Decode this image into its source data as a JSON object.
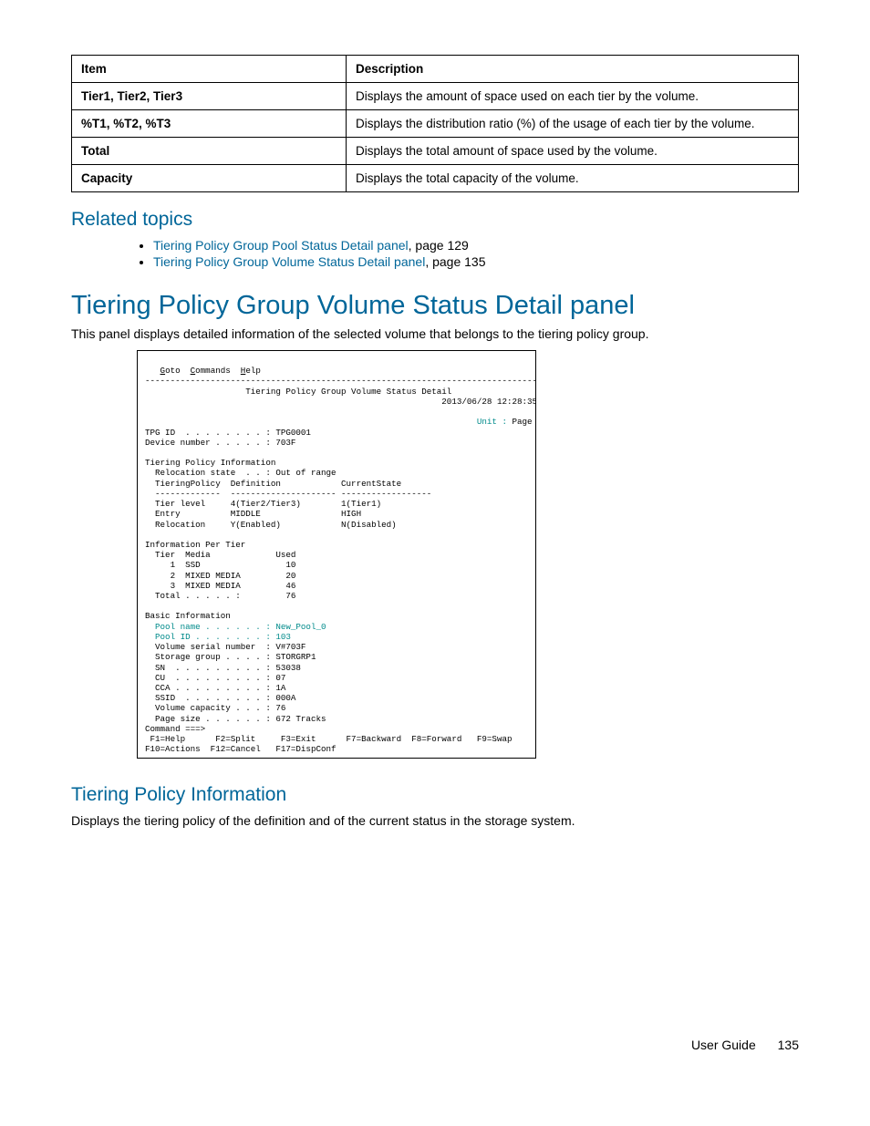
{
  "table": {
    "headers": [
      "Item",
      "Description"
    ],
    "rows": [
      {
        "item": "Tier1, Tier2, Tier3",
        "desc": "Displays the amount of space used on each tier by the volume."
      },
      {
        "item": "%T1, %T2, %T3",
        "desc": "Displays the distribution ratio (%) of the usage of each tier by the volume."
      },
      {
        "item": "Total",
        "desc": "Displays the total amount of space used by the volume."
      },
      {
        "item": "Capacity",
        "desc": "Displays the total capacity of the volume."
      }
    ]
  },
  "related": {
    "heading": "Related topics",
    "items": [
      {
        "link": "Tiering Policy Group Pool Status Detail panel",
        "suffix": ", page 129"
      },
      {
        "link": "Tiering Policy Group Volume Status Detail panel",
        "suffix": ", page 135"
      }
    ]
  },
  "panel": {
    "title": "Tiering Policy Group Volume Status Detail panel",
    "intro": "This panel displays detailed information of the selected volume that belongs to the tiering policy group."
  },
  "terminal": {
    "menu": {
      "goto_u": "G",
      "goto_r": "oto",
      "cmd_u": "C",
      "cmd_r": "ommands",
      "help_u": "H",
      "help_r": "elp"
    },
    "hr": "------------------------------------------------------------------------------",
    "title": "                    Tiering Policy Group Volume Status Detail",
    "timestamp": "                                                           2013/06/28 12:28:35",
    "unit_lbl": "                                                                  Unit :",
    "unit_val": " Page",
    "tpg": "TPG ID  . . . . . . . . : TPG0001",
    "devnum": "Device number . . . . . : 703F",
    "tpi_hdr": "Tiering Policy Information",
    "reloc": "  Relocation state  . . : Out of range",
    "tpdef": "  TieringPolicy  Definition            CurrentState",
    "sep": "  -------------  --------------------- ------------------",
    "tierlv": "  Tier level     4(Tier2/Tier3)        1(Tier1)",
    "entry": "  Entry          MIDDLE                HIGH",
    "relrow": "  Relocation     Y(Enabled)            N(Disabled)",
    "ipt_hdr": "Information Per Tier",
    "ipt_col": "  Tier  Media             Used",
    "ipt_1": "     1  SSD                 10",
    "ipt_2": "     2  MIXED MEDIA         20",
    "ipt_3": "     3  MIXED MEDIA         46",
    "ipt_tot": "  Total . . . . . :         76",
    "bi_hdr": "Basic Information",
    "bi_pn": "  Pool name . . . . . . : New_Pool_0",
    "bi_pid": "  Pool ID . . . . . . . : 103",
    "bi_vsn": "  Volume serial number  : V#703F",
    "bi_sg": "  Storage group . . . . : STORGRP1",
    "bi_sn": "  SN  . . . . . . . . . : 53038",
    "bi_cu": "  CU  . . . . . . . . . : 07",
    "bi_cca": "  CCA . . . . . . . . . : 1A",
    "bi_ssid": "  SSID  . . . . . . . . : 000A",
    "bi_vcap": "  Volume capacity . . . : 76",
    "bi_psz": "  Page size . . . . . . : 672 Tracks",
    "cmd": "Command ===>",
    "fkeys1": " F1=Help      F2=Split     F3=Exit      F7=Backward  F8=Forward   F9=Swap",
    "fkeys2": "F10=Actions  F12=Cancel   F17=DispConf"
  },
  "tpi_section": {
    "heading": "Tiering Policy Information",
    "body": "Displays the tiering policy of the definition and of the current status in the storage system."
  },
  "footer": {
    "label": "User Guide",
    "page": "135"
  }
}
